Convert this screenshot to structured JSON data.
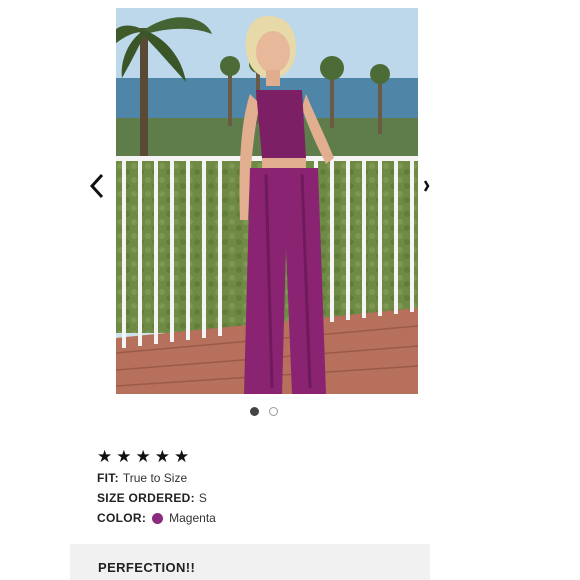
{
  "carousel": {
    "prev_icon": "chevron-left-icon",
    "next_icon": "chevron-right-icon",
    "total_slides": 2,
    "active_slide": 1
  },
  "review": {
    "rating": 5,
    "rating_max": 5,
    "star_glyph": "★",
    "fit_label": "FIT:",
    "fit_value": "True to Size",
    "size_label": "SIZE ORDERED:",
    "size_value": "S",
    "color_label": "COLOR:",
    "color_value": "Magenta",
    "color_swatch": "#8b2a7e",
    "title": "PERFECTION!!"
  }
}
